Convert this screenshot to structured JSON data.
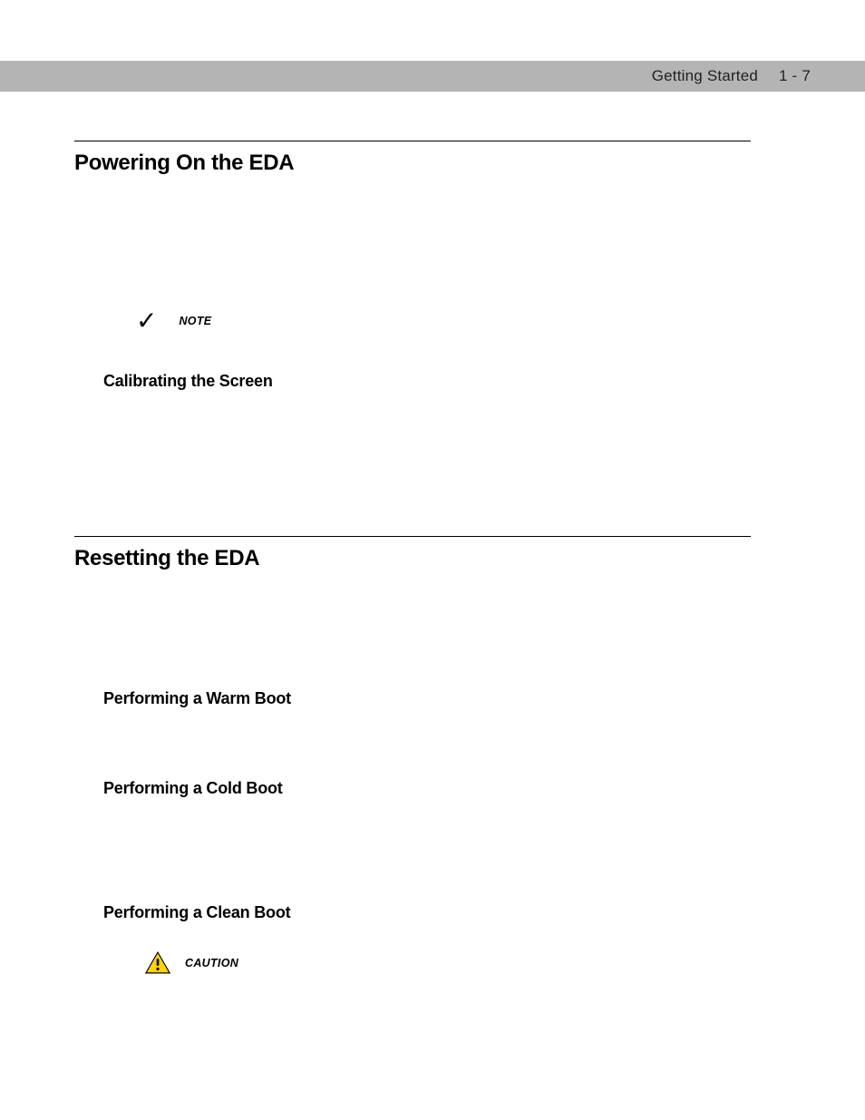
{
  "header": {
    "section": "Getting Started",
    "page_number": "1 - 7"
  },
  "sections": {
    "powering_on": {
      "title": "Powering On the EDA",
      "note_label": "NOTE",
      "calibrating": "Calibrating the Screen"
    },
    "resetting": {
      "title": "Resetting the EDA",
      "warm": "Performing a Warm Boot",
      "cold": "Performing a Cold Boot",
      "clean": "Performing a Clean Boot",
      "caution_label": "CAUTION"
    }
  }
}
